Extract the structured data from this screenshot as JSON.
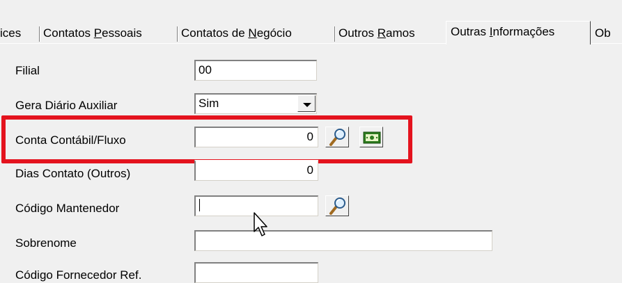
{
  "tabs": [
    {
      "pre": "ices",
      "ul": "",
      "post": ""
    },
    {
      "pre": "Contatos ",
      "ul": "P",
      "post": "essoais"
    },
    {
      "pre": "Contatos de ",
      "ul": "N",
      "post": "egócio"
    },
    {
      "pre": "Outros ",
      "ul": "R",
      "post": "amos"
    },
    {
      "pre": "Outras ",
      "ul": "I",
      "post": "nformações"
    },
    {
      "pre": "Ob",
      "ul": "",
      "post": ""
    }
  ],
  "active_tab_index": 4,
  "form": {
    "filial": {
      "label": "Filial",
      "value": "00"
    },
    "gera_diario": {
      "label": "Gera Diário Auxiliar",
      "value": "Sim"
    },
    "conta_contabil": {
      "label": "Conta Contábil/Fluxo",
      "value": "0"
    },
    "dias_contato": {
      "label": "Dias Contato (Outros)",
      "value": "0"
    },
    "codigo_mantenedor": {
      "label": "Código Mantenedor",
      "value": ""
    },
    "sobrenome": {
      "label": "Sobrenome",
      "value": ""
    },
    "codigo_fornecedor": {
      "label": "Código Fornecedor Ref.",
      "value": ""
    }
  },
  "icons": {
    "lookup": "magnifier-icon",
    "money": "money-note-icon",
    "dropdown": "chevron-down-icon",
    "pointer": "mouse-pointer-icon"
  },
  "colors": {
    "highlight": "#e4131e",
    "background": "#f0f0f0"
  }
}
